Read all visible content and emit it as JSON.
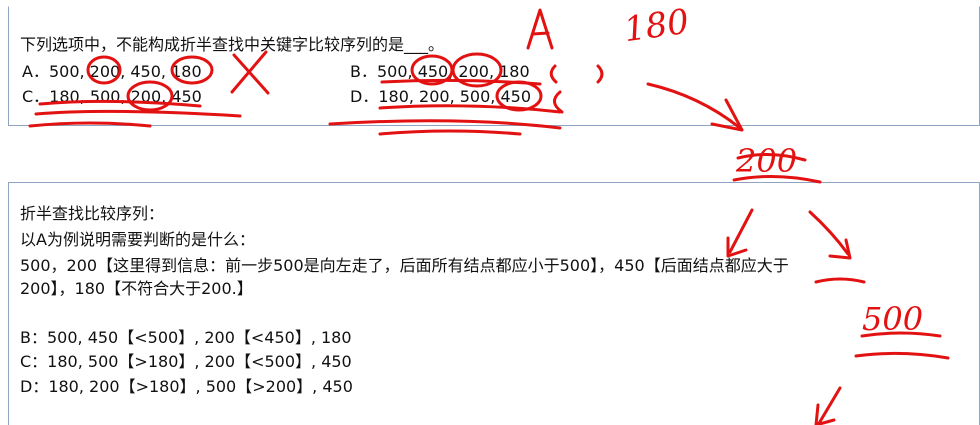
{
  "question": {
    "stem": "下列选项中，不能构成折半查找中关键字比较序列的是",
    "stem_blank": "___。",
    "options": [
      {
        "letter": "A．",
        "seq": "500, 200, 450, 180"
      },
      {
        "letter": "B．",
        "seq": "500, 450, 200, 180"
      },
      {
        "letter": "C．",
        "seq": "180, 500, 200, 450"
      },
      {
        "letter": "D．",
        "seq": "180, 200, 500, 450"
      }
    ]
  },
  "explanation": {
    "title": "折半查找比较序列：",
    "intro": "以A为例说明需要判断的是什么：",
    "line1": "500，200【这里得到信息：前一步500是向左走了，后面所有结点都应小于500】，450【后面结点都应大于",
    "line2": "200】，180【不符合大于200.】",
    "b_line": "B：500, 450【<500】, 200【<450】, 180",
    "c_line": "C：180, 500【>180】, 200【<500】, 450",
    "d_line": "D：180, 200【>180】, 500【>200】, 450"
  },
  "handwriting": {
    "answer_letter": "A",
    "tree_nodes": [
      "180",
      "200",
      "500"
    ],
    "color": "#e31212"
  }
}
